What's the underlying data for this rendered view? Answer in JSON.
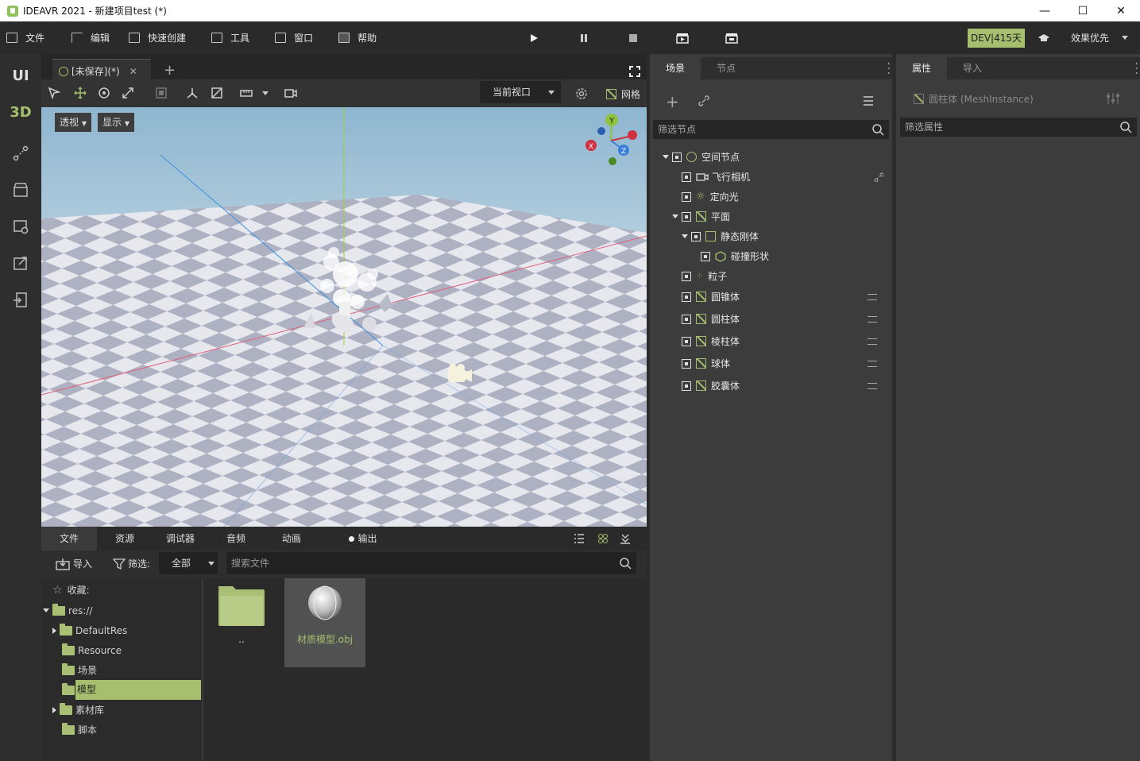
{
  "window": {
    "title": "IDEAVR 2021 - 新建项目test (*)"
  },
  "menu": {
    "file": "文件",
    "edit": "编辑",
    "quick_create": "快速创建",
    "tools": "工具",
    "window": "窗口",
    "help": "帮助"
  },
  "dev_badge": "DEV|415天",
  "render_mode": "效果优先",
  "left_tools": {
    "ui": "UI",
    "three_d": "3D"
  },
  "document_tab": "[未保存](*)",
  "viewport": {
    "current_view": "当前视口",
    "grid": "网格",
    "perspective": "透视",
    "display": "显示"
  },
  "bottom_tabs": [
    "文件",
    "资源",
    "调试器",
    "音频",
    "动画",
    "输出"
  ],
  "file_bar": {
    "import": "导入",
    "filter_label": "筛选:",
    "filter_value": "全部",
    "search_placeholder": "搜索文件"
  },
  "file_tree": {
    "favorites": "收藏:",
    "root": "res://",
    "items": [
      "DefaultRes",
      "Resource",
      "场景",
      "模型",
      "素材库",
      "脚本"
    ],
    "selected": "模型"
  },
  "file_grid": [
    {
      "label": ".."
    },
    {
      "label": "材质模型.obj"
    }
  ],
  "scene_panel": {
    "tabs": [
      "场景",
      "节点"
    ],
    "filter_placeholder": "筛选节点",
    "nodes": [
      {
        "label": "空间节点"
      },
      {
        "label": "飞行相机"
      },
      {
        "label": "定向光"
      },
      {
        "label": "平面"
      },
      {
        "label": "静态刚体"
      },
      {
        "label": "碰撞形状"
      },
      {
        "label": "粒子"
      },
      {
        "label": "圆锥体"
      },
      {
        "label": "圆柱体"
      },
      {
        "label": "棱柱体"
      },
      {
        "label": "球体"
      },
      {
        "label": "胶囊体"
      }
    ]
  },
  "prop_panel": {
    "tabs": [
      "属性",
      "导入"
    ],
    "object": "圆柱体 (MeshInstance)",
    "filter_placeholder": "筛选属性"
  },
  "gizmo": {
    "y": "Y",
    "x": "X",
    "z": "Z"
  },
  "colors": {
    "accent": "#a5bf6e",
    "panel": "#3c3c3c",
    "dark": "#262626"
  }
}
